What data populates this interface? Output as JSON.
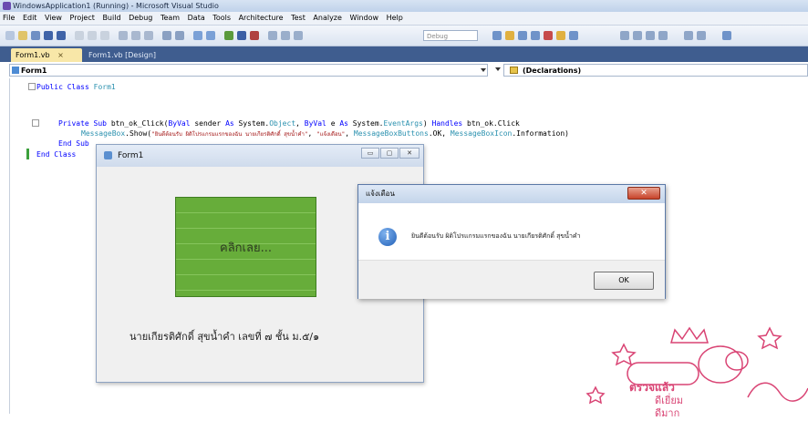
{
  "vs": {
    "title": "WindowsApplication1 (Running) - Microsoft Visual Studio",
    "menu": [
      "File",
      "Edit",
      "View",
      "Project",
      "Build",
      "Debug",
      "Team",
      "Data",
      "Tools",
      "Architecture",
      "Test",
      "Analyze",
      "Window",
      "Help"
    ],
    "toolbar": {
      "debug_select": "Debug"
    },
    "tabs": [
      {
        "label": "Form1.vb",
        "close": "×"
      },
      {
        "label": "Form1.vb [Design]"
      }
    ],
    "nav": {
      "left": "Form1",
      "right": "(Declarations)"
    }
  },
  "code": {
    "line1": {
      "kw": "Public Class",
      "name": "Form1"
    },
    "line2": {
      "kw1": "Private Sub",
      "name": "btn_ok_Click(",
      "kw2": "ByVal",
      "p1": " sender ",
      "kw3": "As",
      "p2": " System.",
      "t1": "Object",
      "p3": ", ",
      "kw4": "ByVal",
      "p4": " e ",
      "kw5": "As",
      "p5": " System.",
      "t2": "EventArgs",
      "p6": ") ",
      "kw6": "Handles",
      "p7": " btn_ok.Click"
    },
    "line3": {
      "t1": "MessageBox",
      "p1": ".Show(",
      "s1": "\"ยินดีต้อนรับ ผิดิโปรแกรมแรกของฉัน นายเกียรติศักดิ์ สุขน้ำคำ\"",
      "p2": ", ",
      "s2": "\"แจ้งเตือน\"",
      "p3": ", ",
      "t2": "MessageBoxButtons",
      "p4": ".OK, ",
      "t3": "MessageBoxIcon",
      "p5": ".Information)"
    },
    "line4": "End Sub",
    "line5": "End Class"
  },
  "form1": {
    "title": "Form1",
    "buttons": {
      "minimize": "▭",
      "maximize": "▢",
      "close": "✕"
    },
    "click_button": "คลิกเลย...",
    "name_label": "นายเกียรติศักดิ์   สุขน้ำคำ   เลขที่ ๗ ชั้น ม.๕/๑"
  },
  "msgbox": {
    "title": "แจ้งเตือน",
    "close": "✕",
    "icon": "i",
    "message": "ยินดีต้อนรับ ผิดิโปรแกรมแรกของฉัน นายเกียรติศักดิ์ สุขน้ำคำ",
    "ok": "OK"
  },
  "sticker": {
    "text": "ตรวจแล้ว",
    "line1": "ดีเยี่ยม",
    "line2": "ดีมาก"
  }
}
